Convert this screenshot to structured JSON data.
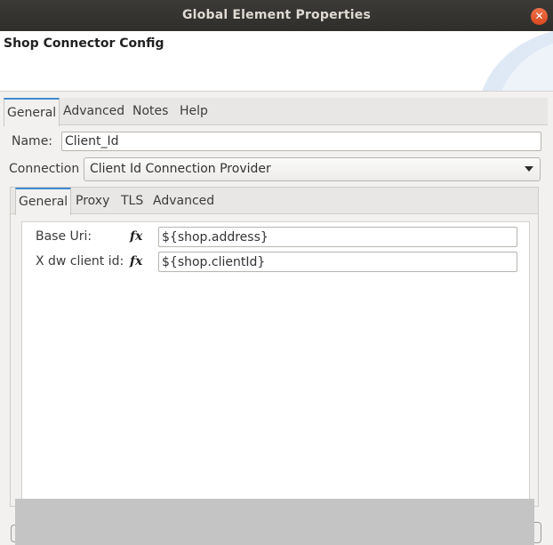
{
  "window": {
    "title": "Global Element Properties",
    "close_glyph": "✕"
  },
  "header": {
    "title": "Shop Connector Config"
  },
  "outer_tabs": [
    {
      "label": "General",
      "active": true
    },
    {
      "label": "Advanced",
      "active": false
    },
    {
      "label": "Notes",
      "active": false
    },
    {
      "label": "Help",
      "active": false
    }
  ],
  "form": {
    "name_label": "Name:",
    "name_value": "Client_Id",
    "connection_label": "Connection",
    "connection_value": "Client Id Connection Provider"
  },
  "inner_tabs": [
    {
      "label": "General",
      "active": true
    },
    {
      "label": "Proxy",
      "active": false
    },
    {
      "label": "TLS",
      "active": false
    },
    {
      "label": "Advanced",
      "active": false
    }
  ],
  "params": [
    {
      "label": "Base Uri:",
      "fx": "fx",
      "value": "${shop.address}"
    },
    {
      "label": "X dw client id:",
      "fx": "fx",
      "value": "${shop.clientId}"
    }
  ],
  "colors": {
    "titlebar": "#2f2e2b",
    "close_button": "#e05a2b",
    "active_tab_accent": "#3f8bd0"
  }
}
